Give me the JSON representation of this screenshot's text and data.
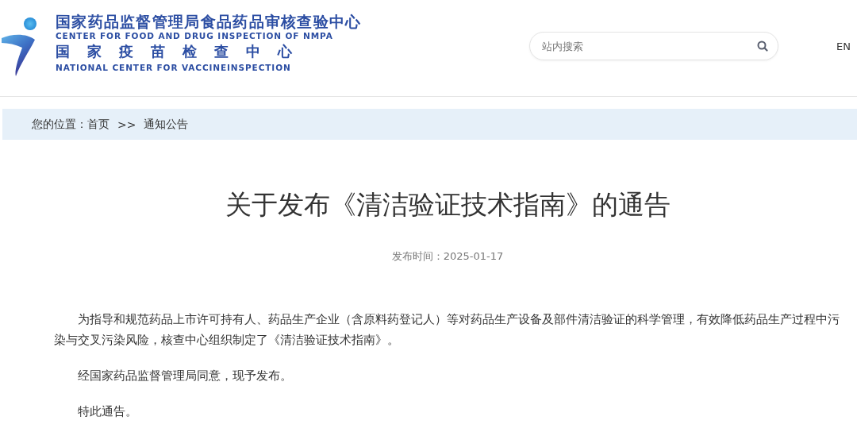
{
  "header": {
    "logo": {
      "name_cn": "国家药品监督管理局食品药品审核查验中心",
      "name_en": "CENTER FOR FOOD AND DRUG INSPECTION OF NMPA",
      "sub_cn": "国家疫苗检查中心",
      "sub_en": "NATIONAL CENTER FOR VACCINEINSPECTION"
    },
    "search": {
      "placeholder": "站内搜索"
    },
    "language": "EN"
  },
  "breadcrumb": {
    "label": "您的位置：",
    "items": [
      "首页",
      "通知公告"
    ],
    "separator": ">>"
  },
  "article": {
    "title": "关于发布《清洁验证技术指南》的通告",
    "date": "发布时间：2025-01-17",
    "paragraphs": [
      "为指导和规范药品上市许可持有人、药品生产企业（含原料药登记人）等对药品生产设备及部件清洁验证的科学管理，有效降低药品生产过程中污染与交叉污染风险，核查中心组织制定了《清洁验证技术指南》。",
      "经国家药品监督管理局同意，现予发布。",
      "特此通告。"
    ]
  }
}
